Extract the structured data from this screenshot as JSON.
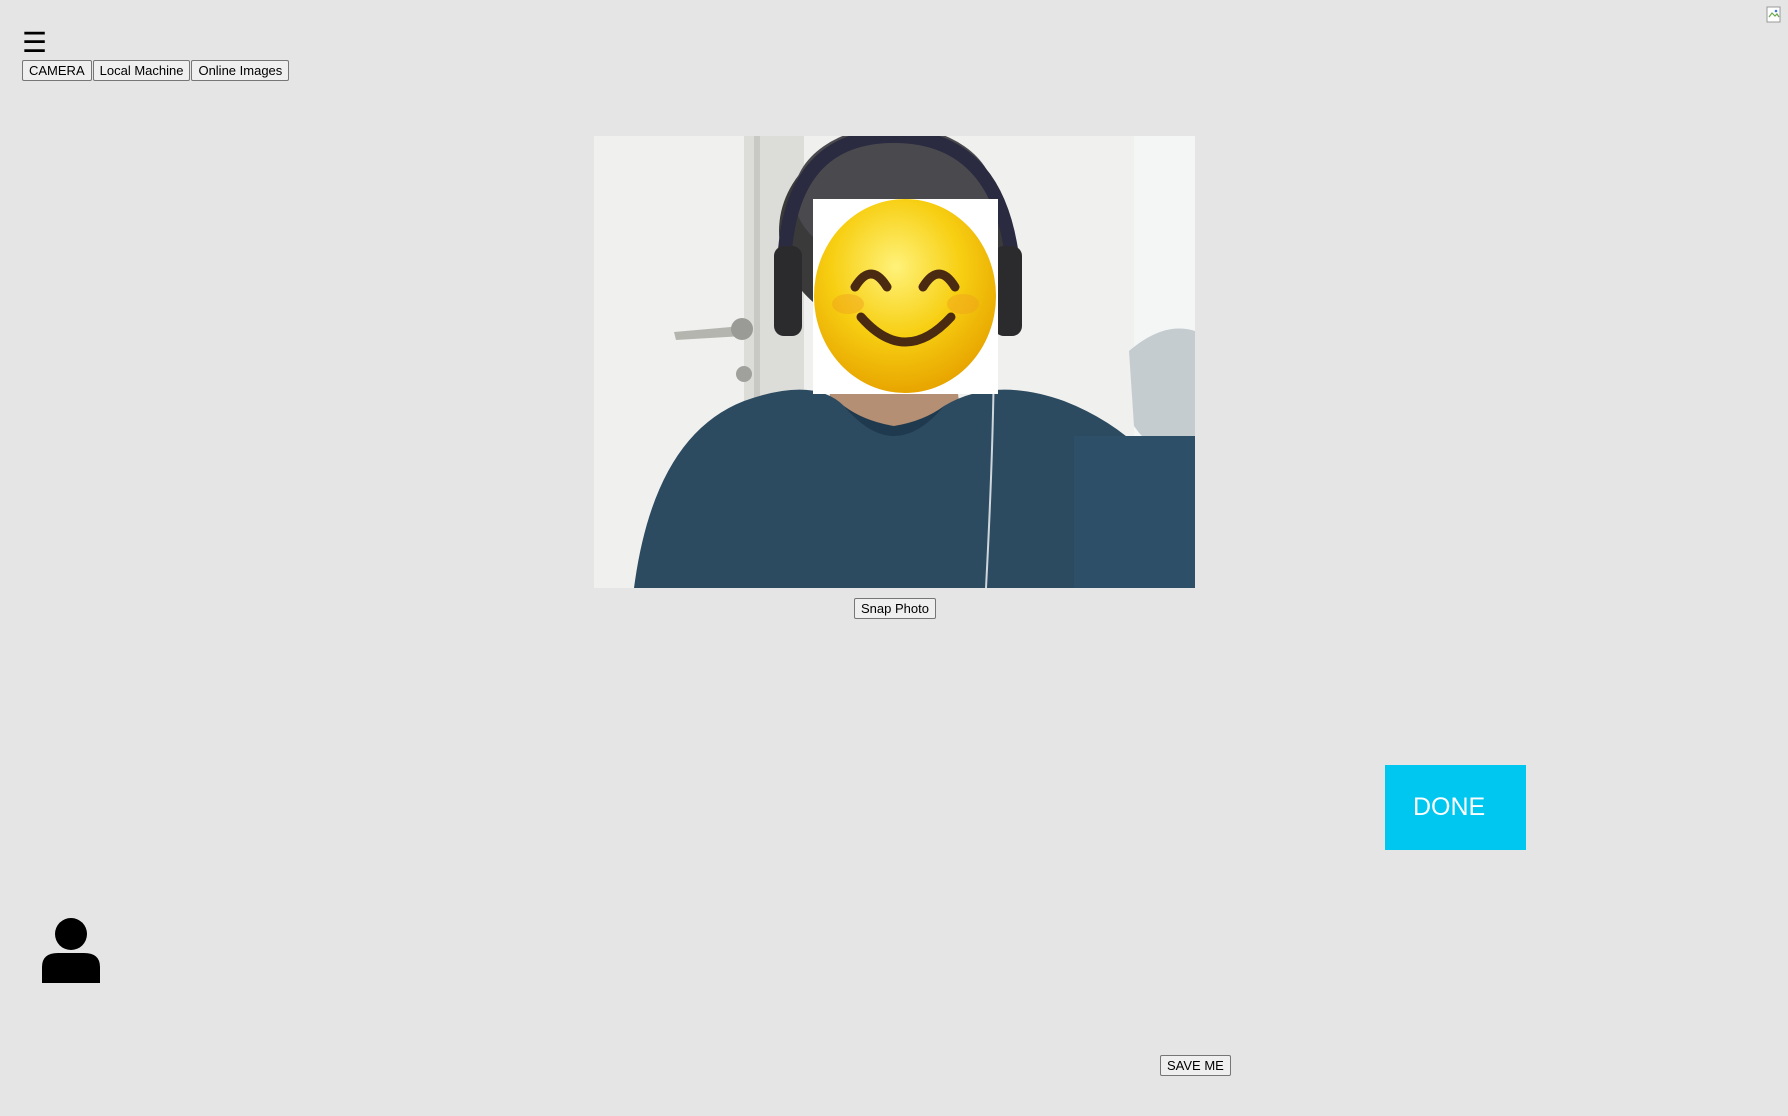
{
  "header": {
    "menu_icon": "☰"
  },
  "source_tabs": [
    {
      "label": "CAMERA"
    },
    {
      "label": "Local Machine"
    },
    {
      "label": "Online Images"
    }
  ],
  "camera": {
    "snap_label": "Snap Photo"
  },
  "actions": {
    "done_label": "DONE",
    "save_label": "SAVE ME"
  },
  "colors": {
    "background": "#e5e5e5",
    "done_button": "#00c7f0",
    "emoji_yellow": "#f5c400"
  },
  "icons": {
    "menu": "hamburger-icon",
    "profile": "user-icon",
    "face_overlay": "smiling-face-emoji",
    "broken_image": "broken-image-icon"
  }
}
